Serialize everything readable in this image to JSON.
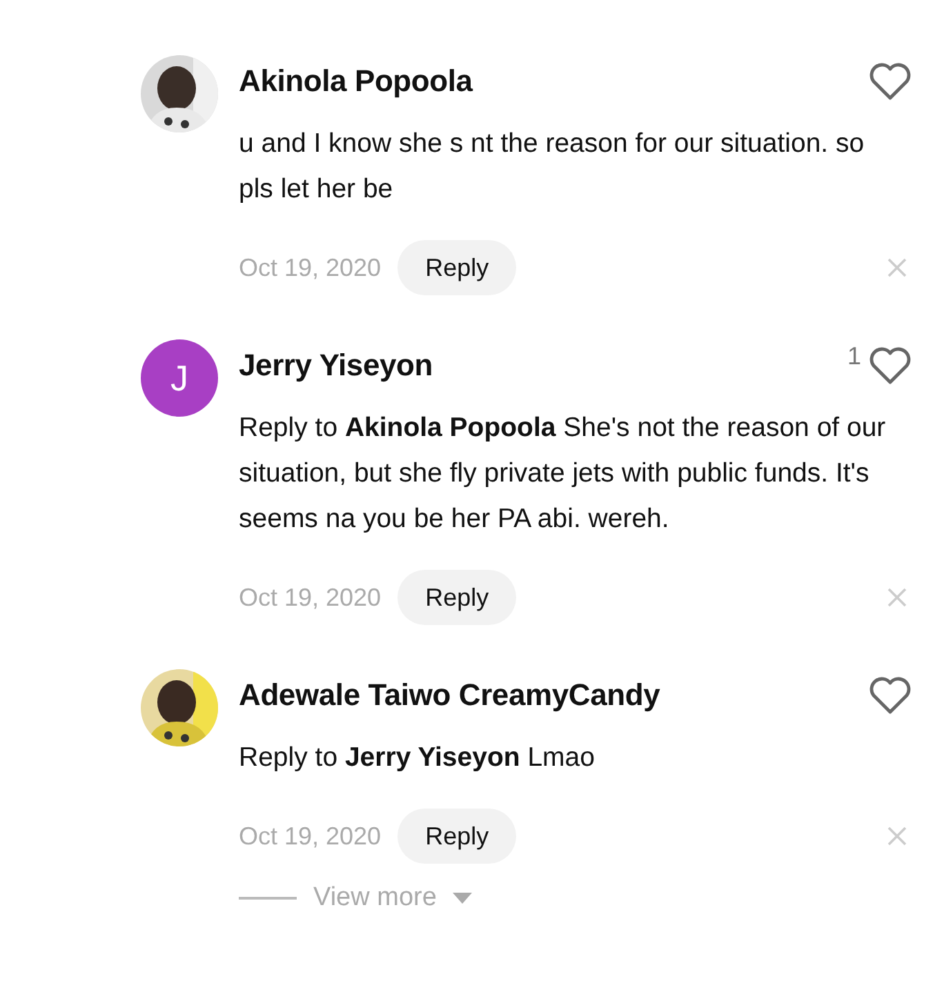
{
  "comments": [
    {
      "author": "Akinola Popoola",
      "text": "u and I know she s nt the reason for our situation. so pls let her be",
      "date": "Oct 19, 2020",
      "reply_button": "Reply",
      "liked": false
    },
    {
      "author": "Jerry Yiseyon",
      "avatar": {
        "kind": "letter",
        "letter": "J",
        "color": "#a83fc4"
      },
      "likes": "1",
      "text": "Reply to **Akinola Popoola** She's not the reason of our situation, but she fly private jets with public funds. It's seems na you be her PA abi. wereh.",
      "date": "Oct 19, 2020",
      "reply_button": "Reply",
      "liked": false
    },
    {
      "author": "Adewale Taiwo CreamyCandy",
      "text": "Reply to **Jerry Yiseyon** Lmao",
      "date": "Oct 19, 2020",
      "reply_button": "Reply",
      "liked": false
    }
  ],
  "view_more": "View more"
}
